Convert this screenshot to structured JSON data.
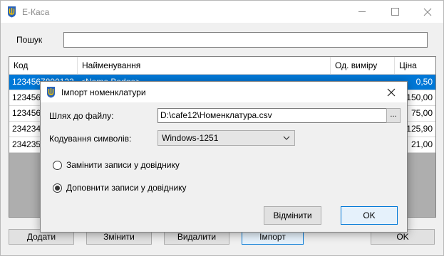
{
  "window": {
    "title": "E-Каса",
    "icon": "trident-icon"
  },
  "search": {
    "label": "Пошук",
    "value": ""
  },
  "grid": {
    "columns": [
      "Код",
      "Найменування",
      "Од. виміру",
      "Ціна"
    ],
    "rows": [
      {
        "code": "1234567890123",
        "name": "<Name Badge>",
        "unit": "",
        "price": "0,50",
        "selected": true
      },
      {
        "code": "123456",
        "name": "",
        "unit": "",
        "price": "150,00"
      },
      {
        "code": "123456",
        "name": "",
        "unit": "",
        "price": "75,00"
      },
      {
        "code": "234234",
        "name": "",
        "unit": "",
        "price": "125,90"
      },
      {
        "code": "234235",
        "name": "",
        "unit": "",
        "price": "21,00"
      }
    ]
  },
  "buttons": {
    "add": "Додати",
    "edit": "Змінити",
    "delete": "Видалити",
    "import": "Імпорт",
    "ok": "OK"
  },
  "dialog": {
    "title": "Імпорт номенклатури",
    "path_label": "Шлях до файлу:",
    "path_value": "D:\\cafe12\\Номенклатура.csv",
    "browse_label": "...",
    "encoding_label": "Кодування символів:",
    "encoding_value": "Windows-1251",
    "radio_replace": "Замінити записи у довіднику",
    "radio_append": "Доповнити записи у довіднику",
    "selected_option": "append",
    "cancel": "Відмінити",
    "ok": "OK"
  },
  "colors": {
    "selection": "#0078d7",
    "grid_bg": "#aeaeae",
    "window_bg": "#f0f0f0"
  }
}
